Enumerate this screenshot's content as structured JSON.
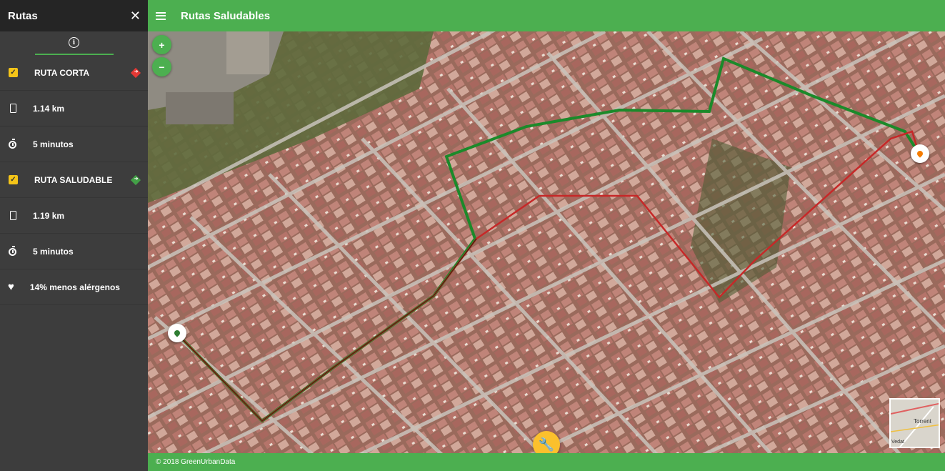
{
  "sidebar": {
    "title": "Rutas",
    "close_icon": "close-icon",
    "tab_icon": "info-icon",
    "items": [
      {
        "label": "RUTA CORTA",
        "icon": "checkbox-checked",
        "route_color": "#e53935"
      },
      {
        "label": "1.14 km",
        "icon": "phone-icon"
      },
      {
        "label": "5 minutos",
        "icon": "timer-icon"
      },
      {
        "label": "RUTA SALUDABLE",
        "icon": "checkbox-checked",
        "route_color": "#43a047"
      },
      {
        "label": "1.19 km",
        "icon": "phone-icon"
      },
      {
        "label": "5 minutos",
        "icon": "timer-icon"
      },
      {
        "label": "14% menos alérgenos",
        "icon": "heart-icon"
      }
    ]
  },
  "header": {
    "title": "Rutas Saludables",
    "menu_icon": "menu-icon"
  },
  "map": {
    "zoom_in": "+",
    "zoom_out": "−",
    "fab_icon": "wrench-icon",
    "start_marker_color": "#2e7d32",
    "end_marker_color": "#f57c00",
    "minimap_label_1": "Torrent",
    "minimap_label_2": "Vedat"
  },
  "footer": {
    "text": "© 2018 GreenUrbanData"
  },
  "colors": {
    "accent": "#4caf50",
    "sidebar_bg": "#3d3d3d",
    "short_route": "#c62828",
    "healthy_route": "#1b8a2a",
    "fab": "#fbc02d"
  }
}
